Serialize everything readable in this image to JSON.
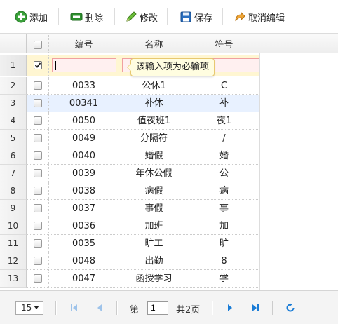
{
  "toolbar": {
    "add": "添加",
    "delete": "删除",
    "edit": "修改",
    "save": "保存",
    "cancel_edit": "取消编辑"
  },
  "columns": {
    "code": "编号",
    "name": "名称",
    "symbol": "符号"
  },
  "editing_row": {
    "row_number": "1",
    "checked": true,
    "code_value": "",
    "name_value": "",
    "symbol_value": ""
  },
  "validation_tooltip": "该输入项为必输项",
  "rows": [
    {
      "n": "2",
      "code": "0033",
      "name": "公休1",
      "symbol": "C"
    },
    {
      "n": "3",
      "code": "00341",
      "name": "补休",
      "symbol": "补"
    },
    {
      "n": "4",
      "code": "0050",
      "name": "值夜班1",
      "symbol": "夜1"
    },
    {
      "n": "5",
      "code": "0049",
      "name": "分隔符",
      "symbol": "/"
    },
    {
      "n": "6",
      "code": "0040",
      "name": "婚假",
      "symbol": "婚"
    },
    {
      "n": "7",
      "code": "0039",
      "name": "年休公假",
      "symbol": "公"
    },
    {
      "n": "8",
      "code": "0038",
      "name": "病假",
      "symbol": "病"
    },
    {
      "n": "9",
      "code": "0037",
      "name": "事假",
      "symbol": "事"
    },
    {
      "n": "10",
      "code": "0036",
      "name": "加班",
      "symbol": "加"
    },
    {
      "n": "11",
      "code": "0035",
      "name": "旷工",
      "symbol": "旷"
    },
    {
      "n": "12",
      "code": "0048",
      "name": "出勤",
      "symbol": "8"
    },
    {
      "n": "13",
      "code": "0047",
      "name": "函授学习",
      "symbol": "学"
    }
  ],
  "highlighted_row": "3",
  "pager": {
    "page_size": "15",
    "page_prefix": "第",
    "page_value": "1",
    "page_total": "共2页"
  },
  "colors": {
    "editing_row_bg": "#fff6d2",
    "hover_row_bg": "#e8f1ff",
    "error_border": "#f0a0a0",
    "icon_blue": "#1a7cd6",
    "icon_green": "#2e9a2e"
  }
}
